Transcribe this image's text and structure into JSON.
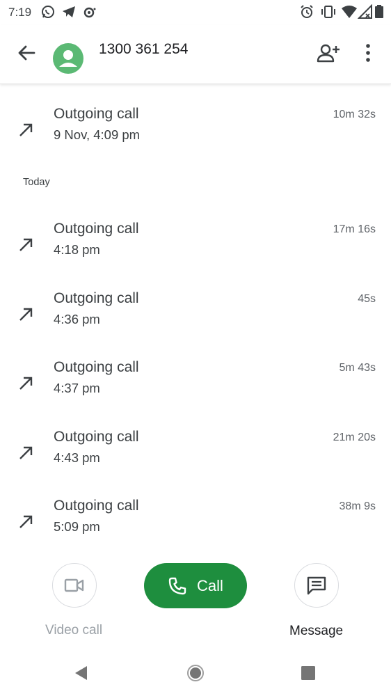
{
  "status_bar": {
    "time": "7:19",
    "left_icons": [
      "whatsapp-icon",
      "telegram-icon",
      "signal-icon"
    ],
    "right_icons": [
      "alarm-icon",
      "vibrate-icon",
      "wifi-icon",
      "cell-signal-icon",
      "battery-icon"
    ]
  },
  "header": {
    "number": "1300 361 254",
    "icons": [
      "back-arrow-icon",
      "avatar",
      "add-contact-icon",
      "more-vert-icon"
    ],
    "avatar_color": "#5bb974"
  },
  "history": {
    "earlier": [
      {
        "type": "Outgoing call",
        "time": "9 Nov, 4:09 pm",
        "duration": "10m 32s"
      }
    ],
    "today_label": "Today",
    "today": [
      {
        "type": "Outgoing call",
        "time": "4:18 pm",
        "duration": "17m 16s"
      },
      {
        "type": "Outgoing call",
        "time": "4:36 pm",
        "duration": "45s"
      },
      {
        "type": "Outgoing call",
        "time": "4:37 pm",
        "duration": "5m 43s"
      },
      {
        "type": "Outgoing call",
        "time": "4:43 pm",
        "duration": "21m 20s"
      },
      {
        "type": "Outgoing call",
        "time": "5:09 pm",
        "duration": "38m 9s"
      }
    ]
  },
  "actions": {
    "video_call": "Video call",
    "call": "Call",
    "message": "Message",
    "call_color": "#1e8e3e",
    "disabled_color": "#9aa0a6"
  },
  "nav": {
    "icons": [
      "nav-back-icon",
      "nav-home-icon",
      "nav-recents-icon"
    ]
  }
}
